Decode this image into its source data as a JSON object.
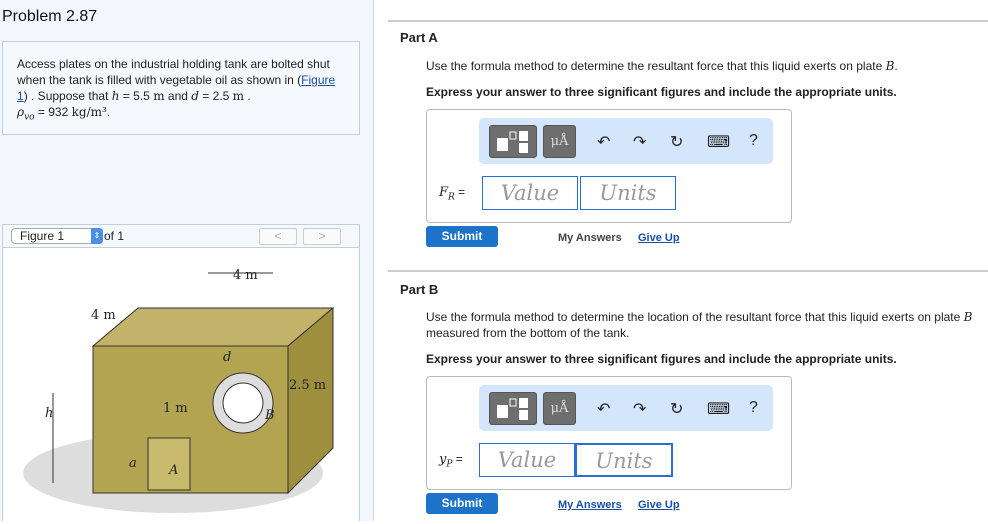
{
  "problem": {
    "title": "Problem 2.87",
    "text_1": "Access plates on the industrial holding tank are bolted shut when the tank is filled with vegetable oil as shown in (",
    "figure_link": "Figure 1",
    "text_2": ") . Suppose that ",
    "h_var": "h",
    "h_val": " = 5.5 ",
    "unit_m": "m",
    "and": " and ",
    "d_var": "d",
    "d_val": " = 2.5 ",
    "period": " .",
    "rho": "ρ",
    "rho_sub": "vo",
    "rho_val": " = 932 ",
    "rho_unit": "kg/m³",
    "end": "."
  },
  "figure": {
    "select": "Figure 1",
    "of": "of 1",
    "prev": "<",
    "next": ">",
    "labels": {
      "top": "4 m",
      "left": "4 m",
      "depth": "2.5 m",
      "h": "h",
      "one_m": "1 m",
      "d": "d",
      "B": "B",
      "a": "a",
      "A": "A"
    }
  },
  "parts": [
    {
      "title": "Part A",
      "question": "Use the formula method to determine the resultant force that this liquid exerts on plate ",
      "plate": "B",
      "q_end": ".",
      "instruction": "Express your answer to three significant figures and include the appropriate units.",
      "var": "F",
      "sub": "R",
      "eq": " =",
      "value_ph": "Value",
      "units_ph": "Units",
      "submit": "Submit",
      "my_answers": "My Answers",
      "give_up": "Give Up"
    },
    {
      "title": "Part B",
      "question": "Use the formula method to determine the location of the resultant force that this liquid exerts on plate ",
      "plate": "B",
      "q_end": " measured from the bottom of the tank.",
      "instruction": "Express your answer to three significant figures and include the appropriate units.",
      "var": "y",
      "sub": "P",
      "eq": " =",
      "value_ph": "Value",
      "units_ph": "Units",
      "submit": "Submit",
      "my_answers": "My Answers",
      "give_up": "Give Up"
    }
  ],
  "toolbar": {
    "mu": "μÅ",
    "undo": "↶",
    "redo": "↷",
    "reset": "↻",
    "keyboard": "⌨",
    "help": "?"
  }
}
